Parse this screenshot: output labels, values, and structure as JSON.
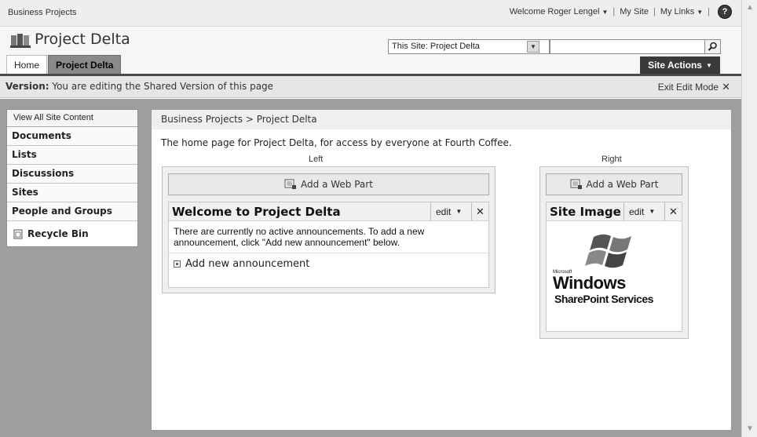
{
  "topbar": {
    "site_name": "Business Projects",
    "welcome": "Welcome Roger Lengel",
    "my_site": "My Site",
    "my_links": "My Links",
    "sep": "|"
  },
  "title_area": {
    "site_title": "Project Delta",
    "search_scope": "This Site: Project Delta",
    "search_value": "",
    "tabs": [
      {
        "label": "Home"
      },
      {
        "label": "Project Delta"
      }
    ],
    "site_actions": "Site Actions"
  },
  "edit_bar": {
    "label_bold": "Version:",
    "label_text": " You are editing the Shared Version of this page",
    "exit_label": "Exit Edit Mode"
  },
  "quick_launch": {
    "view_all": "View All Site Content",
    "items": [
      {
        "label": "Documents"
      },
      {
        "label": "Lists"
      },
      {
        "label": "Discussions"
      },
      {
        "label": "Sites"
      },
      {
        "label": "People and Groups"
      }
    ],
    "recycle_bin": "Recycle Bin"
  },
  "content": {
    "breadcrumb": "Business Projects > Project Delta",
    "description": "The home page for Project Delta, for access by everyone at Fourth Coffee.",
    "left_zone": {
      "label": "Left",
      "add_web_part": "Add a Web Part",
      "web_part": {
        "title": "Welcome to Project Delta",
        "edit": "edit",
        "body": "There are currently no active announcements. To add a new announcement, click \"Add new announcement\" below.",
        "add_link": "Add new announcement"
      }
    },
    "right_zone": {
      "label": "Right",
      "add_web_part": "Add a Web Part",
      "web_part": {
        "title": "Site Image",
        "edit": "edit",
        "logo_microsoft": "Microsoft",
        "logo_windows": "Windows",
        "logo_sharepoint": "SharePoint Services"
      }
    }
  }
}
